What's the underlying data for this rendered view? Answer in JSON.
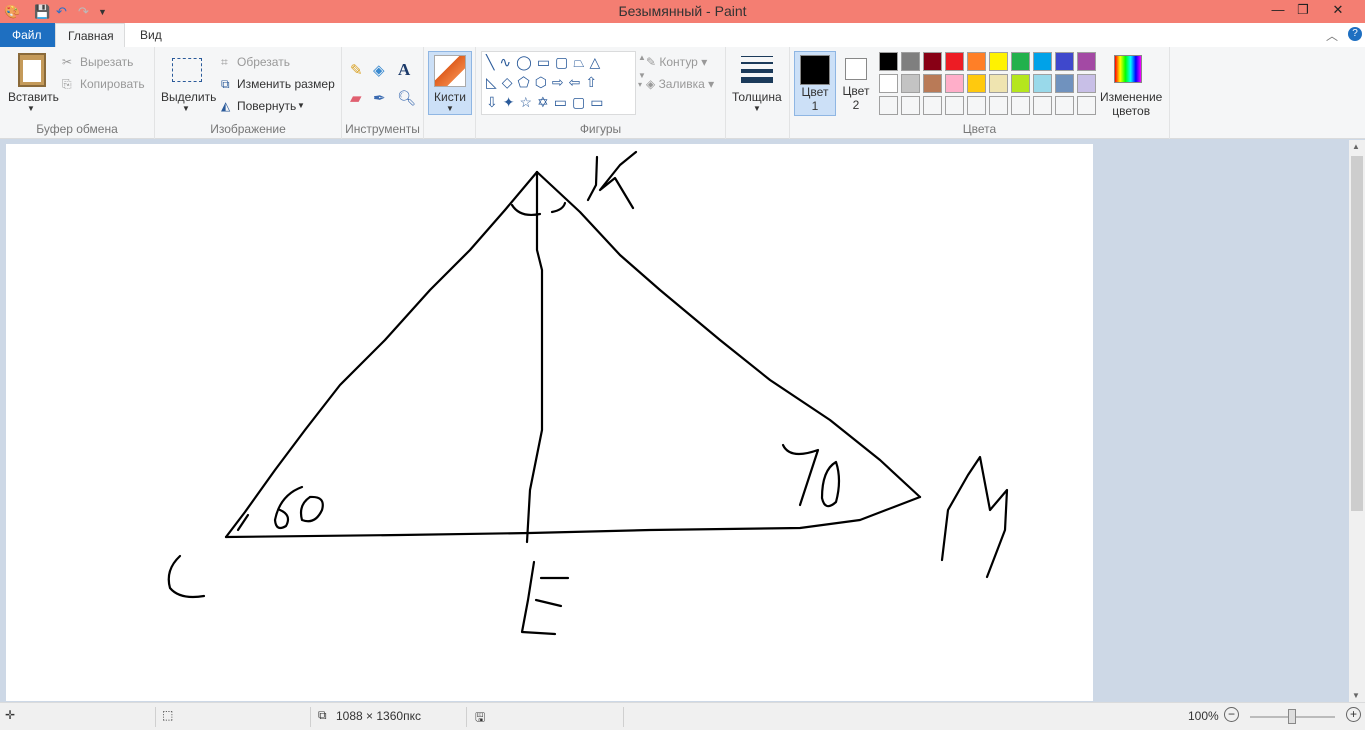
{
  "window": {
    "title": "Безымянный - Paint",
    "minimize": "—",
    "restore": "❐",
    "close": "✕"
  },
  "tabs": [
    {
      "label": "Файл"
    },
    {
      "label": "Главная"
    },
    {
      "label": "Вид"
    }
  ],
  "clipboard": {
    "paste": "Вставить",
    "cut": "Вырезать",
    "copy": "Копировать",
    "label": "Буфер обмена"
  },
  "image": {
    "select": "Выделить",
    "crop": "Обрезать",
    "resize": "Изменить размер",
    "rotate": "Повернуть",
    "label": "Изображение"
  },
  "tools": {
    "label": "Инструменты",
    "text_tool": "A"
  },
  "brushes": {
    "label": "Кисти"
  },
  "shapes": {
    "outline": "Контур",
    "fill": "Заливка",
    "label": "Фигуры"
  },
  "size": {
    "label": "Толщина"
  },
  "colors": {
    "color1": "Цвет",
    "color1_num": "1",
    "color2": "Цвет",
    "color2_num": "2",
    "edit": "Изменение",
    "edit2": "цветов",
    "label": "Цвета",
    "palette": [
      "#000000",
      "#7f7f7f",
      "#880015",
      "#ed1c24",
      "#ff7f27",
      "#fff200",
      "#22b14c",
      "#00a2e8",
      "#3f48cc",
      "#a349a4",
      "#ffffff",
      "#c3c3c3",
      "#b97a57",
      "#ffaec9",
      "#ffc90e",
      "#efe4b0",
      "#b5e61d",
      "#99d9ea",
      "#7092be",
      "#c8bfe7"
    ]
  },
  "status": {
    "dimensions": "1088 × 1360пкс",
    "zoom": "100%"
  }
}
